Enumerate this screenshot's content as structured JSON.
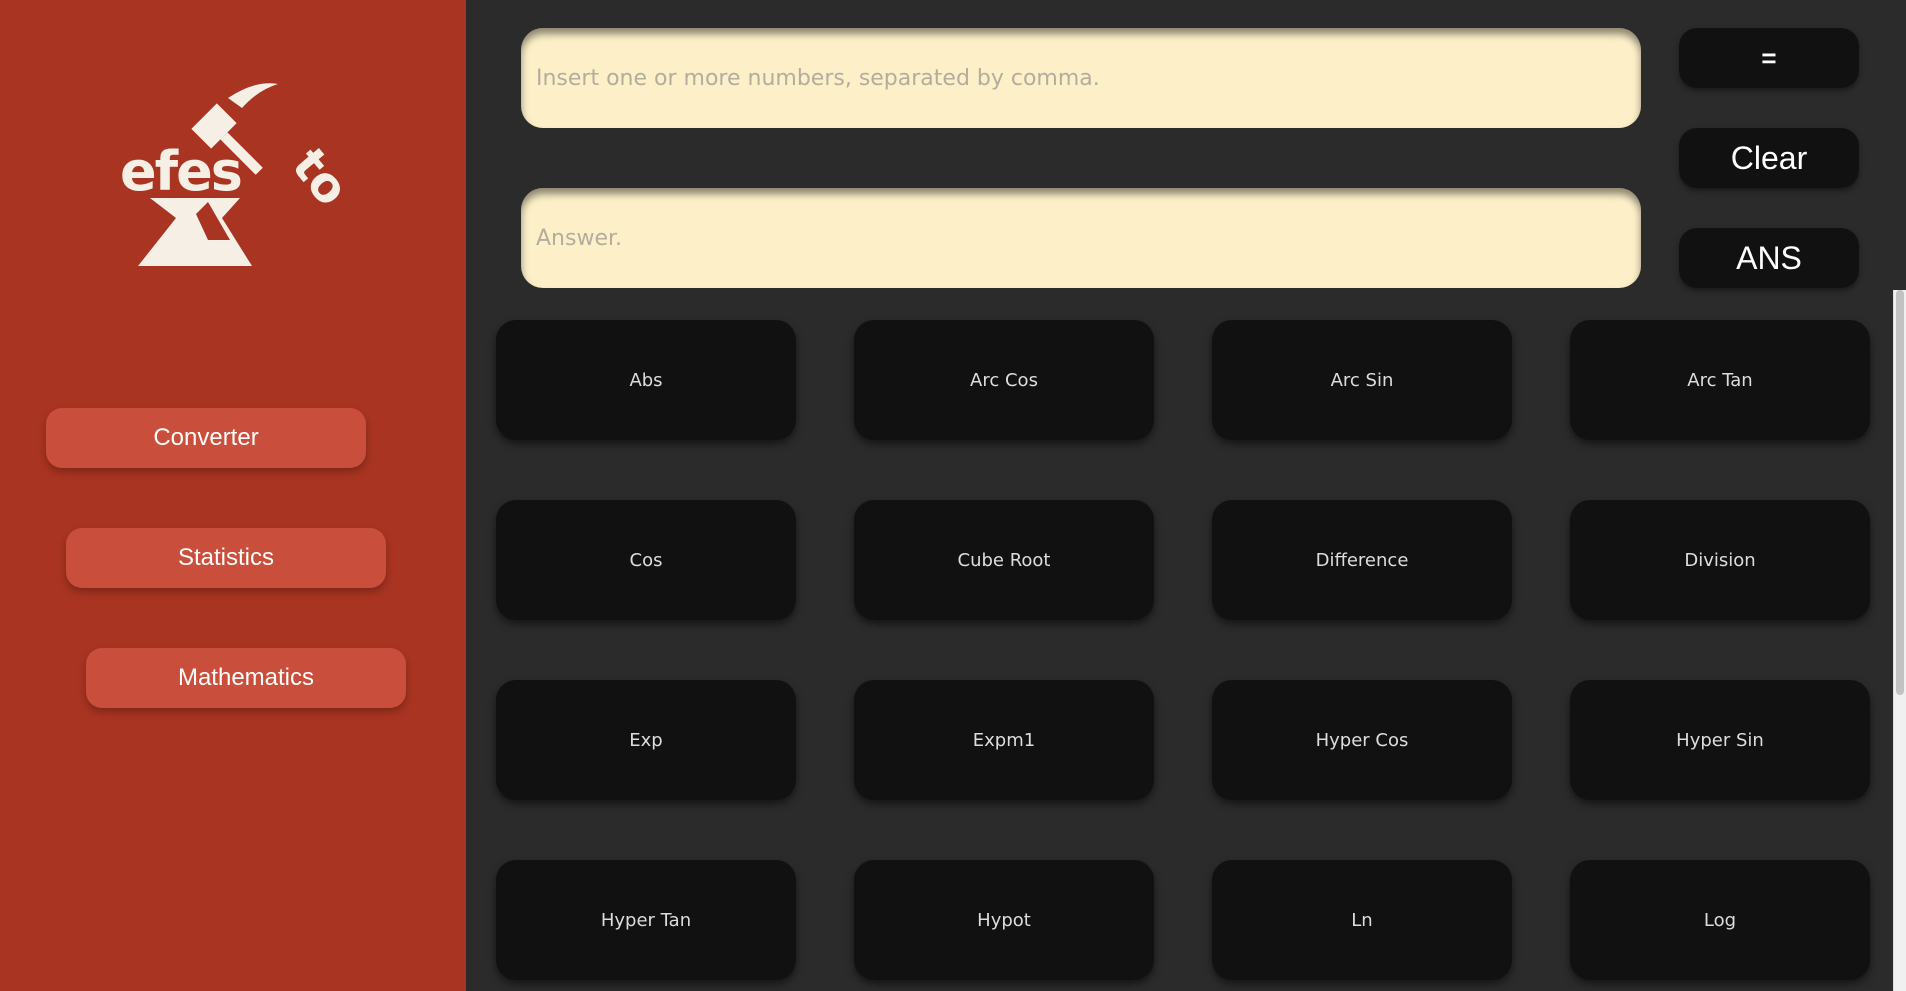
{
  "sidebar": {
    "logo_text": "efesto",
    "nav": [
      {
        "label": "Converter"
      },
      {
        "label": "Statistics"
      },
      {
        "label": "Mathematics"
      }
    ]
  },
  "calculator": {
    "input_placeholder": "Insert one or more numbers, separated by comma.",
    "answer_placeholder": "Answer.",
    "equals_label": "=",
    "clear_label": "Clear",
    "ans_label": "ANS"
  },
  "functions": [
    "Abs",
    "Arc Cos",
    "Arc Sin",
    "Arc Tan",
    "Cos",
    "Cube Root",
    "Difference",
    "Division",
    "Exp",
    "Expm1",
    "Hyper Cos",
    "Hyper Sin",
    "Hyper Tan",
    "Hypot",
    "Ln",
    "Log"
  ],
  "colors": {
    "sidebar_bg": "#a93421",
    "nav_button_bg": "#c94e3b",
    "main_bg": "#2b2b2b",
    "field_bg": "#fdf0c9",
    "button_bg": "#111111"
  }
}
